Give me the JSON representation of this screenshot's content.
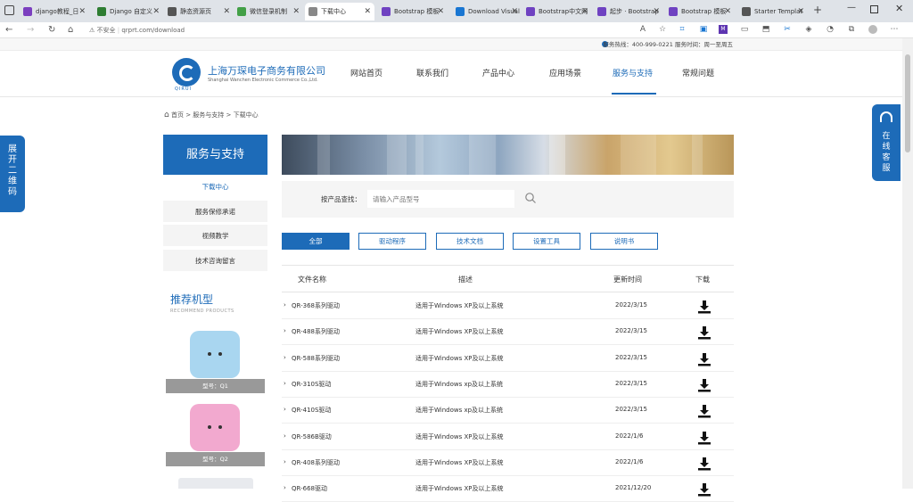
{
  "browser": {
    "tabs": [
      {
        "label": "django教程_日",
        "color": "#7b3fbf"
      },
      {
        "label": "Django 自定义",
        "color": "#2e7d32"
      },
      {
        "label": "静态资源页",
        "color": "#555555"
      },
      {
        "label": "微信登录机制",
        "color": "#43a047"
      },
      {
        "label": "下载中心",
        "color": "#888888"
      },
      {
        "label": "Bootstrap 模板",
        "color": "#6f42c1"
      },
      {
        "label": "Download Visual",
        "color": "#1976d2"
      },
      {
        "label": "Bootstrap中文网",
        "color": "#6f42c1"
      },
      {
        "label": "起步 · Bootstrap",
        "color": "#6f42c1"
      },
      {
        "label": "Bootstrap 模板",
        "color": "#6f42c1"
      },
      {
        "label": "Starter Templat",
        "color": "#555555"
      }
    ],
    "active_tab": 4,
    "security_label": "不安全",
    "url": "qrprt.com/download"
  },
  "topstrip": {
    "hotline": "服务热线：400-999-0221 服务时间：周一至周五"
  },
  "header": {
    "company_name": "上海万琛电子商务有限公司",
    "company_en": "Shanghai Wanchen Electronic Commerce Co.,Ltd.",
    "logo_sub": "QIRUI",
    "nav": [
      "网站首页",
      "联系我们",
      "产品中心",
      "应用场景",
      "服务与支持",
      "常规问题"
    ],
    "active_nav": 4
  },
  "breadcrumb": {
    "items": [
      "首页",
      "服务与支持",
      "下载中心"
    ],
    "separator": ">"
  },
  "float_left": {
    "label": "展开二维码"
  },
  "float_right": {
    "label": "在线客服"
  },
  "sidebar": {
    "title": "服务与支持",
    "items": [
      "下载中心",
      "服务保修承诺",
      "视频教学",
      "技术咨询留言"
    ],
    "active": 0,
    "recommend_title": "推荐机型",
    "recommend_en": "RECOMMEND PRODUCTS",
    "products": [
      {
        "caption": "型号：Q1",
        "color": "#a9d6f0"
      },
      {
        "caption": "型号：Q2",
        "color": "#f2a9cf"
      }
    ]
  },
  "search": {
    "label": "按产品查找：",
    "placeholder": "请输入产品型号"
  },
  "filters": {
    "items": [
      "全部",
      "驱动程序",
      "技术文档",
      "设置工具",
      "说明书"
    ],
    "active": 0
  },
  "table": {
    "headers": [
      "文件名称",
      "描述",
      "更新时间",
      "下载"
    ],
    "rows": [
      {
        "name": "QR-368系列驱动",
        "desc": "适用于Windows XP及以上系统",
        "date": "2022/3/15"
      },
      {
        "name": "QR-488系列驱动",
        "desc": "适用于Windows XP及以上系统",
        "date": "2022/3/15"
      },
      {
        "name": "QR-588系列驱动",
        "desc": "适用于Windows XP及以上系统",
        "date": "2022/3/15"
      },
      {
        "name": "QR-310S驱动",
        "desc": "适用于Windows xp及以上系统",
        "date": "2022/3/15"
      },
      {
        "name": "QR-410S驱动",
        "desc": "适用于Windows xp及以上系统",
        "date": "2022/3/15"
      },
      {
        "name": "QR-586B驱动",
        "desc": "适用于Windows XP及以上系统",
        "date": "2022/1/6"
      },
      {
        "name": "QR-408系列驱动",
        "desc": "适用于Windows XP及以上系统",
        "date": "2022/1/6"
      },
      {
        "name": "QR-668驱动",
        "desc": "适用于Windows XP及以上系统",
        "date": "2021/12/20"
      }
    ]
  }
}
